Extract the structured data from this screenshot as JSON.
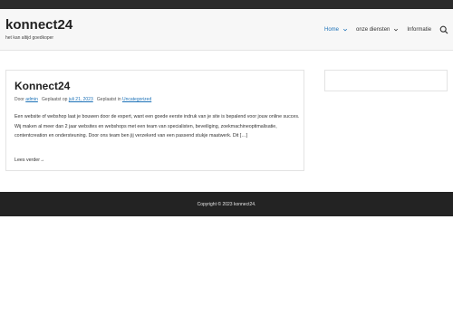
{
  "header": {
    "site_title": "konnect24",
    "tagline": "het kan altijd goedkoper"
  },
  "nav": {
    "items": [
      {
        "label": "Home",
        "active": true,
        "has_dropdown": true
      },
      {
        "label": "onze diensten",
        "active": false,
        "has_dropdown": true
      },
      {
        "label": "Informatie",
        "active": false,
        "has_dropdown": false
      }
    ],
    "search_icon": "search-icon"
  },
  "post": {
    "title": "Konnect24",
    "meta_by": "Door",
    "author": "admin",
    "meta_posted_on": "Geplaatst op",
    "date": "juli 21, 2023",
    "meta_posted_in": "Geplaatst in",
    "category": "Uncategorized",
    "excerpt": "Een website of webshop laat je bouwen door de expert, want een goede eerste indruk van je site is bepalend voor jouw online succes. Wij maken al meer dan 2 jaar websites en webshops met een team van specialisten, beveiliging, zoekmachineoptimalisatie, contentcreation en ondersteuning. Door ons team ben jij verzekerd van een passend stukje maatwerk. Dit […]",
    "read_more": "Lees verder→"
  },
  "footer": {
    "copyright": "Copyright © 2023 konnect24."
  },
  "colors": {
    "accent": "#1d72b8",
    "footer_bg": "#232323",
    "topbar_bg": "#2b2b2b"
  }
}
